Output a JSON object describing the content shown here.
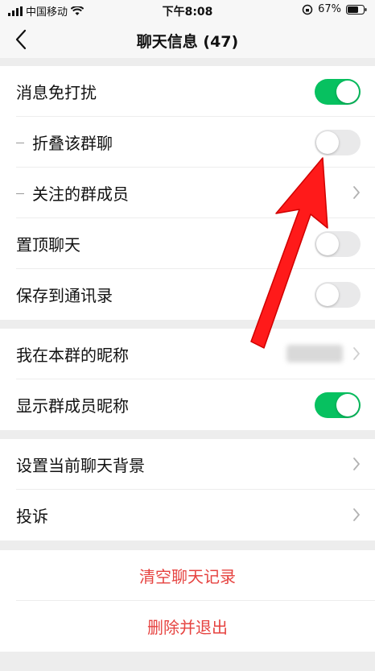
{
  "status_bar": {
    "carrier": "中国移动",
    "time": "下午8:08",
    "battery": "67%"
  },
  "nav": {
    "title": "聊天信息 (47)"
  },
  "section1": {
    "rows": [
      {
        "label": "消息免打扰",
        "toggle": "on"
      },
      {
        "label": "折叠该群聊",
        "toggle": "off"
      },
      {
        "label": "关注的群成员"
      },
      {
        "label": "置顶聊天",
        "toggle": "off"
      },
      {
        "label": "保存到通讯录",
        "toggle": "off"
      }
    ]
  },
  "section2": {
    "rows": [
      {
        "label": "我在本群的昵称"
      },
      {
        "label": "显示群成员昵称",
        "toggle": "on"
      }
    ]
  },
  "section3": {
    "rows": [
      {
        "label": "设置当前聊天背景"
      },
      {
        "label": "投诉"
      }
    ]
  },
  "section4": {
    "clear_label": "清空聊天记录",
    "delete_label": "删除并退出"
  },
  "colors": {
    "accent_green": "#07C160",
    "danger_red": "#E64340",
    "arrow_red": "#FF0000"
  },
  "icons": [
    "signal-icon",
    "wifi-icon",
    "back-icon",
    "chevron-right-icon",
    "lock-rotation-icon",
    "battery-icon"
  ]
}
